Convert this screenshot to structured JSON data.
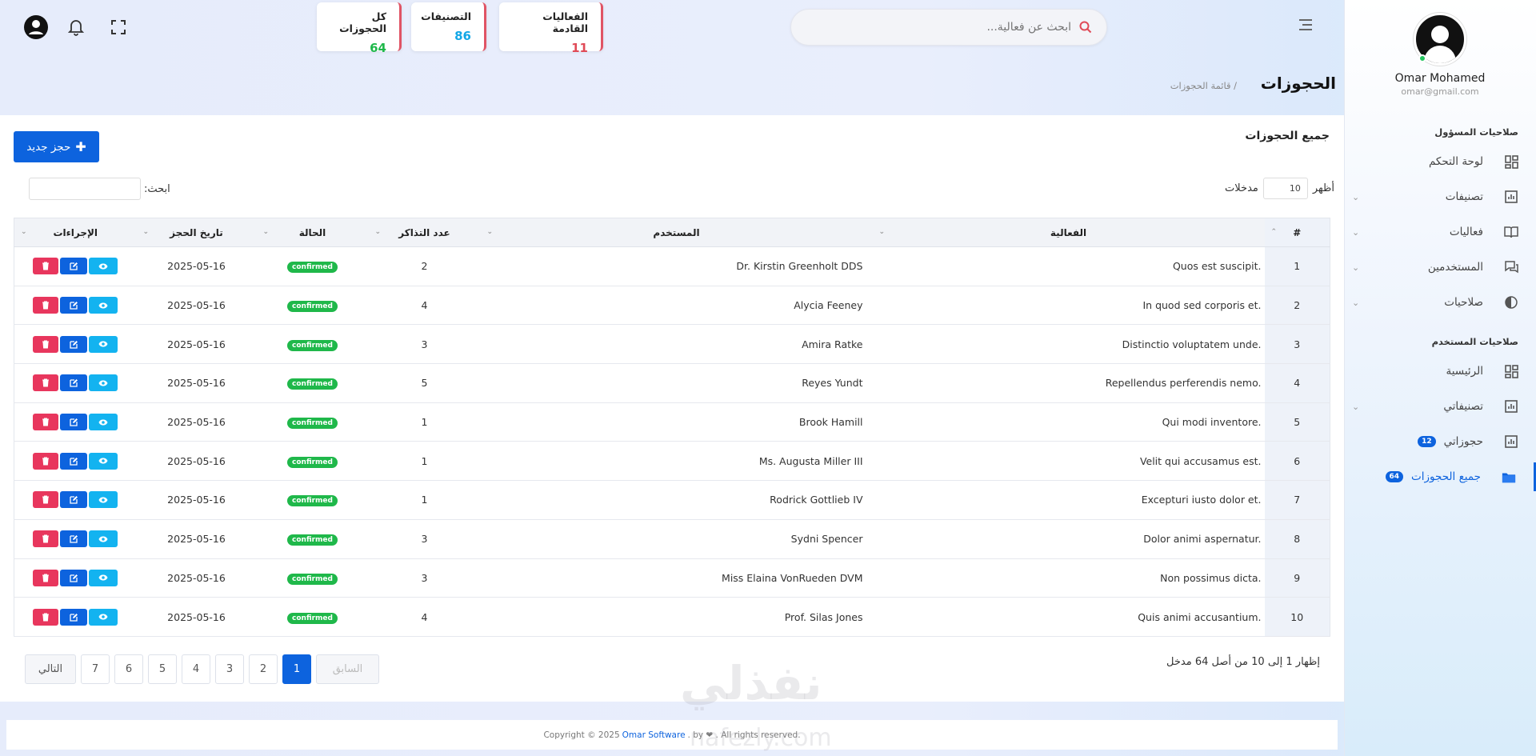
{
  "profile": {
    "name": "Omar Mohamed",
    "email": "omar@gmail.com"
  },
  "sidebar": {
    "admin_section": "صلاحيات المسؤول",
    "user_section": "صلاحيات المستخدم",
    "admin_items": [
      {
        "label": "لوحة التحكم",
        "icon": "dashboard-icon"
      },
      {
        "label": "تصنيفات",
        "icon": "chart-icon"
      },
      {
        "label": "فعاليات",
        "icon": "book-icon"
      },
      {
        "label": "المستخدمين",
        "icon": "chat-icon"
      },
      {
        "label": "صلاحيات",
        "icon": "globe-icon"
      }
    ],
    "user_items": [
      {
        "label": "الرئيسية",
        "icon": "dashboard-icon"
      },
      {
        "label": "تصنيفاتي",
        "icon": "chart-icon"
      },
      {
        "label": "حجوزاتي",
        "icon": "chart-icon",
        "badge": "12"
      },
      {
        "label": "جميع الحجوزات",
        "icon": "folder-icon",
        "badge": "64"
      }
    ]
  },
  "search": {
    "placeholder": "ابحث عن فعالية..."
  },
  "stats": [
    {
      "label": "الفعاليات القادمة",
      "value": "11",
      "color": "#e04a57"
    },
    {
      "label": "التصنيفات",
      "value": "86",
      "color": "#13a7e6"
    },
    {
      "label": "كل الحجوزات",
      "value": "64",
      "color": "#1fb84a"
    }
  ],
  "page": {
    "title": "الحجوزات",
    "breadcrumb": "/ قائمة الحجوزات"
  },
  "card": {
    "title": "جميع الحجوزات",
    "new_button": "حجز جديد",
    "show_label": "أظهر",
    "entries_label": "مدخلات",
    "page_length": "10",
    "search_label": "ابحث:"
  },
  "table": {
    "headers": [
      "#",
      "الفعالية",
      "المستخدم",
      "عدد التذاكر",
      "الحالة",
      "تاريخ الحجز",
      "الإجراءات"
    ],
    "rows": [
      {
        "num": "1",
        "event": "Quos est suscipit.",
        "user": "Dr. Kirstin Greenholt DDS",
        "tickets": "2",
        "status": "confirmed",
        "date": "2025-05-16"
      },
      {
        "num": "2",
        "event": "In quod sed corporis et.",
        "user": "Alycia Feeney",
        "tickets": "4",
        "status": "confirmed",
        "date": "2025-05-16"
      },
      {
        "num": "3",
        "event": "Distinctio voluptatem unde.",
        "user": "Amira Ratke",
        "tickets": "3",
        "status": "confirmed",
        "date": "2025-05-16"
      },
      {
        "num": "4",
        "event": "Repellendus perferendis nemo.",
        "user": "Reyes Yundt",
        "tickets": "5",
        "status": "confirmed",
        "date": "2025-05-16"
      },
      {
        "num": "5",
        "event": "Qui modi inventore.",
        "user": "Brook Hamill",
        "tickets": "1",
        "status": "confirmed",
        "date": "2025-05-16"
      },
      {
        "num": "6",
        "event": "Velit qui accusamus est.",
        "user": "Ms. Augusta Miller III",
        "tickets": "1",
        "status": "confirmed",
        "date": "2025-05-16"
      },
      {
        "num": "7",
        "event": "Excepturi iusto dolor et.",
        "user": "Rodrick Gottlieb IV",
        "tickets": "1",
        "status": "confirmed",
        "date": "2025-05-16"
      },
      {
        "num": "8",
        "event": "Dolor animi aspernatur.",
        "user": "Sydni Spencer",
        "tickets": "3",
        "status": "confirmed",
        "date": "2025-05-16"
      },
      {
        "num": "9",
        "event": "Non possimus dicta.",
        "user": "Miss Elaina VonRueden DVM",
        "tickets": "3",
        "status": "confirmed",
        "date": "2025-05-16"
      },
      {
        "num": "10",
        "event": "Quis animi accusantium.",
        "user": "Prof. Silas Jones",
        "tickets": "4",
        "status": "confirmed",
        "date": "2025-05-16"
      }
    ]
  },
  "pagination": {
    "info": "إظهار 1 إلى 10 من أصل 64 مدخل",
    "prev": "السابق",
    "next": "التالي",
    "pages": [
      "1",
      "2",
      "3",
      "4",
      "5",
      "6",
      "7"
    ],
    "active": "1"
  },
  "footer": {
    "prefix": "Copyright © 2025",
    "brand": "Omar Software",
    "suffix": ". by ❤ . All rights reserved."
  },
  "watermark": {
    "arabic": "نفذلي",
    "latin": "nafezly.com"
  },
  "colors": {
    "primary": "#0d63de",
    "success": "#1fb84a",
    "danger": "#e8365d",
    "info": "#13b3f0"
  }
}
